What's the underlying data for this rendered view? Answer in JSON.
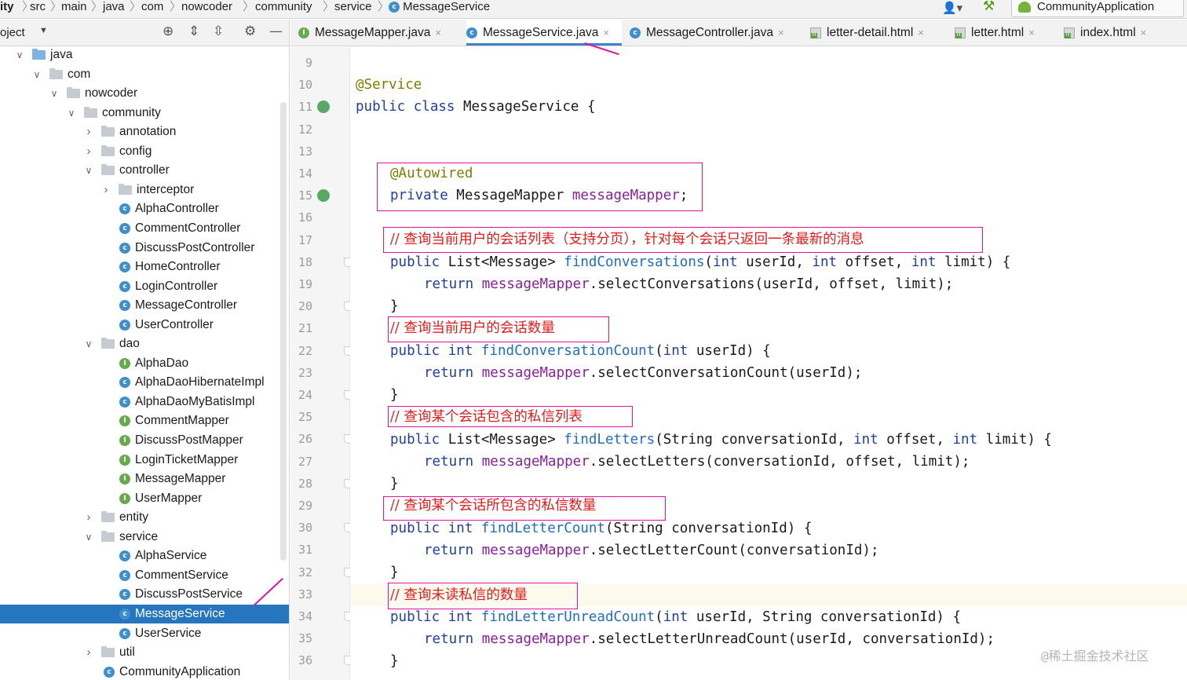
{
  "breadcrumb": [
    "ity",
    "src",
    "main",
    "java",
    "com",
    "nowcoder",
    "community",
    "service",
    "MessageService"
  ],
  "run_config": "CommunityApplication",
  "project_panel": {
    "title": "oject"
  },
  "tree": [
    {
      "label": "java",
      "type": "folder-blue",
      "expanded": true
    },
    {
      "label": "com",
      "type": "folder",
      "expanded": true
    },
    {
      "label": "nowcoder",
      "type": "folder",
      "expanded": true
    },
    {
      "label": "community",
      "type": "folder",
      "expanded": true
    },
    {
      "label": "annotation",
      "type": "folder",
      "expanded": false
    },
    {
      "label": "config",
      "type": "folder",
      "expanded": false
    },
    {
      "label": "controller",
      "type": "folder",
      "expanded": true
    },
    {
      "label": "interceptor",
      "type": "folder",
      "expanded": false
    },
    {
      "label": "AlphaController",
      "type": "class"
    },
    {
      "label": "CommentController",
      "type": "class"
    },
    {
      "label": "DiscussPostController",
      "type": "class"
    },
    {
      "label": "HomeController",
      "type": "class"
    },
    {
      "label": "LoginController",
      "type": "class"
    },
    {
      "label": "MessageController",
      "type": "class"
    },
    {
      "label": "UserController",
      "type": "class"
    },
    {
      "label": "dao",
      "type": "folder",
      "expanded": true
    },
    {
      "label": "AlphaDao",
      "type": "interface"
    },
    {
      "label": "AlphaDaoHibernateImpl",
      "type": "class"
    },
    {
      "label": "AlphaDaoMyBatisImpl",
      "type": "class"
    },
    {
      "label": "CommentMapper",
      "type": "interface"
    },
    {
      "label": "DiscussPostMapper",
      "type": "interface"
    },
    {
      "label": "LoginTicketMapper",
      "type": "interface"
    },
    {
      "label": "MessageMapper",
      "type": "interface"
    },
    {
      "label": "UserMapper",
      "type": "interface"
    },
    {
      "label": "entity",
      "type": "folder",
      "expanded": false
    },
    {
      "label": "service",
      "type": "folder",
      "expanded": true
    },
    {
      "label": "AlphaService",
      "type": "class"
    },
    {
      "label": "CommentService",
      "type": "class"
    },
    {
      "label": "DiscussPostService",
      "type": "class"
    },
    {
      "label": "MessageService",
      "type": "class",
      "selected": true
    },
    {
      "label": "UserService",
      "type": "class"
    },
    {
      "label": "util",
      "type": "folder",
      "expanded": false
    },
    {
      "label": "CommunityApplication",
      "type": "app"
    }
  ],
  "tabs": [
    {
      "label": "MessageMapper.java",
      "type": "interface"
    },
    {
      "label": "MessageService.java",
      "type": "class",
      "active": true
    },
    {
      "label": "MessageController.java",
      "type": "class"
    },
    {
      "label": "letter-detail.html",
      "type": "html"
    },
    {
      "label": "letter.html",
      "type": "html"
    },
    {
      "label": "index.html",
      "type": "html"
    }
  ],
  "line_numbers": [
    "9",
    "10",
    "11",
    "12",
    "13",
    "14",
    "15",
    "16",
    "17",
    "18",
    "19",
    "20",
    "21",
    "22",
    "23",
    "24",
    "25",
    "26",
    "27",
    "28",
    "29",
    "30",
    "31",
    "32",
    "33",
    "34",
    "35",
    "36"
  ],
  "code": {
    "l10": "@Service",
    "l11_kw": "public class ",
    "l11_rest": "MessageService {",
    "l14": "@Autowired",
    "l15_kw": "private ",
    "l15_type": "MessageMapper ",
    "l15_fld": "messageMapper",
    "l15_end": ";",
    "c17": "// 查询当前用户的会话列表（支持分页），针对每个会话只返回一条最新的消息",
    "l18_a": "public ",
    "l18_b": "List<Message> ",
    "l18_m": "findConversations",
    "l18_c": "(",
    "l18_d": "int ",
    "l18_e": "userId, ",
    "l18_f": "int ",
    "l18_g": "offset, ",
    "l18_h": "int ",
    "l18_i": "limit) {",
    "l19_kw": "return ",
    "l19_fld": "messageMapper",
    "l19_rest": ".selectConversations(userId, offset, limit);",
    "brace": "}",
    "c21": "// 查询当前用户的会话数量",
    "l22_a": "public ",
    "l22_b": "int ",
    "l22_m": "findConversationCount",
    "l22_c": "(",
    "l22_d": "int ",
    "l22_e": "userId) {",
    "l23_kw": "return ",
    "l23_fld": "messageMapper",
    "l23_rest": ".selectConversationCount(userId);",
    "c25": "// 查询某个会话包含的私信列表",
    "l26_a": "public ",
    "l26_b": "List<Message> ",
    "l26_m": "findLetters",
    "l26_c": "(String conversationId, ",
    "l26_d": "int ",
    "l26_e": "offset, ",
    "l26_f": "int ",
    "l26_g": "limit) {",
    "l27_kw": "return ",
    "l27_fld": "messageMapper",
    "l27_rest": ".selectLetters(conversationId, offset, limit);",
    "c29": "// 查询某个会话所包含的私信数量",
    "l30_a": "public ",
    "l30_b": "int ",
    "l30_m": "findLetterCount",
    "l30_c": "(String conversationId) {",
    "l31_kw": "return ",
    "l31_fld": "messageMapper",
    "l31_rest": ".selectLetterCount(conversationId);",
    "c33": "// 查询未读私信的数量",
    "l34_a": "public ",
    "l34_b": "int ",
    "l34_m": "findLetterUnreadCount",
    "l34_c": "(",
    "l34_d": "int ",
    "l34_e": "userId, String conversationId) {",
    "l35_kw": "return ",
    "l35_fld": "messageMapper",
    "l35_rest": ".selectLetterUnreadCount(userId, conversationId);"
  },
  "watermark": "@稀土掘金技术社区",
  "colors": {
    "selection": "#2675bf",
    "highlight_box": "#e0139c",
    "keyword": "#1f3fa3",
    "method": "#1f6ec3",
    "field": "#8a1f9e",
    "comment": "#e31b1b",
    "annotation": "#7d7d00"
  }
}
